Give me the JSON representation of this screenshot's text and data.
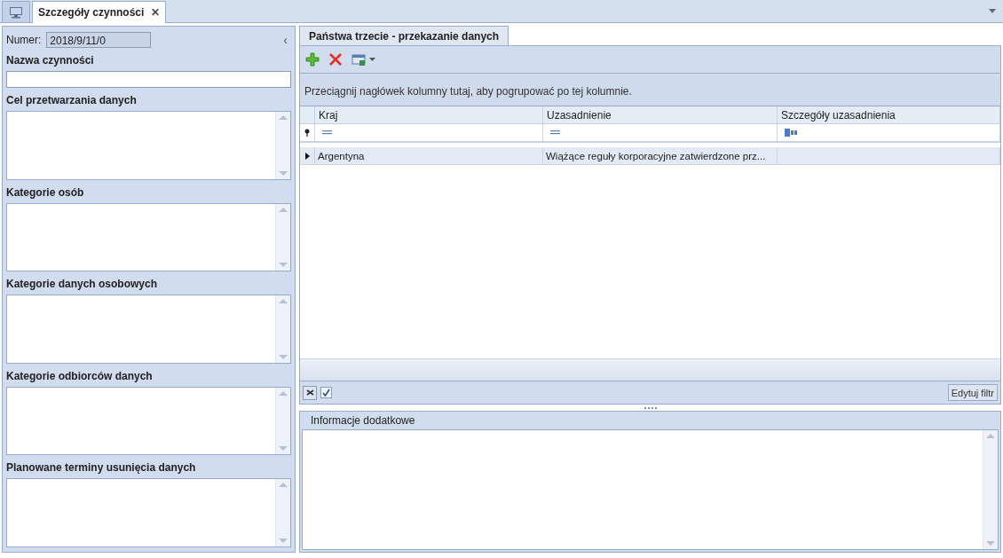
{
  "document_tabs": [
    {
      "kind": "icon",
      "selected": false
    },
    {
      "kind": "text",
      "label": "Szczegóły czynności",
      "selected": true,
      "close": "✕"
    }
  ],
  "left_panel": {
    "number_label": "Numer:",
    "number_value": "2018/9/11/0",
    "collapse": "‹",
    "name_label": "Nazwa czynności",
    "sections": [
      {
        "label": "Cel przetwarzania danych"
      },
      {
        "label": "Kategorie osób"
      },
      {
        "label": "Kategorie danych osobowych"
      },
      {
        "label": "Kategorie odbiorców danych"
      },
      {
        "label": "Planowane terminy usunięcia danych"
      }
    ]
  },
  "right_tab": {
    "label": "Państwa trzecie - przekazanie danych",
    "selected": true
  },
  "group_hint": "Przeciągnij nagłówek kolumny tutaj, aby pogrupować po tej kolumnie.",
  "table": {
    "columns": [
      "Kraj",
      "Uzasadnienie",
      "Szczegóły uzasadnienia"
    ],
    "filter_row": [
      {
        "kind": "equals"
      },
      {
        "kind": "equals"
      },
      {
        "kind": "text"
      }
    ],
    "rows": [
      {
        "cells": [
          "Argentyna",
          "Wiążące reguły korporacyjne zatwierdzone prz...",
          ""
        ],
        "selected": true
      }
    ]
  },
  "filter_bar": {
    "enabled": true,
    "edit_button": "Edytuj filtr"
  },
  "info_panel": {
    "title": "Informacje dodatkowe"
  }
}
